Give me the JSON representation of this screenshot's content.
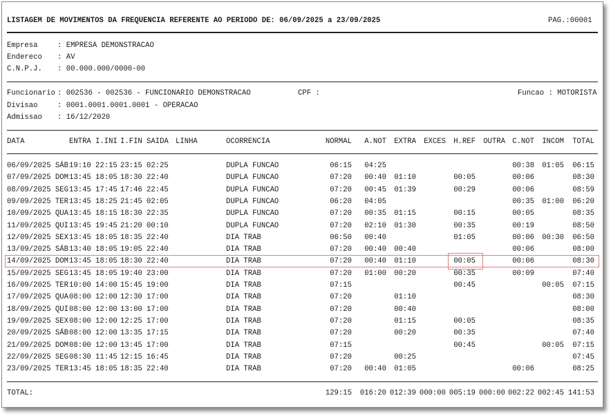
{
  "report": {
    "title": "LISTAGEM DE MOVIMENTOS DA FREQUENCIA REFERENTE AO PERIODO DE: 06/09/2025 a 23/09/2025",
    "page": "PAG.:00001"
  },
  "company": [
    {
      "label": "Empresa",
      "value": ": EMPRESA DEMONSTRACAO"
    },
    {
      "label": "Endereco",
      "value": ": AV"
    },
    {
      "label": "C.N.P.J.",
      "value": ": 00.000.000/0000-00"
    }
  ],
  "employee": {
    "funcionario_label": "Funcionario",
    "funcionario_value": ": 002536 - 002536 - FUNCIONARIO DEMONSTRACAO",
    "cpf": "CPF :",
    "funcao": "Funcao : MOTORISTA",
    "divisao_label": "Divisao",
    "divisao_value": ": 0001.0001.0001.0001 - OPERACAO",
    "admissao_label": "Admissao",
    "admissao_value": ": 16/12/2020"
  },
  "columns": {
    "data": "DATA",
    "entra": "ENTRA",
    "iini": "I.INI",
    "ifin": "I.FIN",
    "saida": "SAIDA",
    "linha": "LINHA",
    "ocorrencia": "OCORRENCIA",
    "normal": "NORMAL",
    "anot": "A.NOT",
    "extra": "EXTRA",
    "exces": "EXCES",
    "href": "H.REF",
    "outra": "OUTRA",
    "cnot": "C.NOT",
    "incom": "INCOM",
    "total": "TOTAL"
  },
  "rows": [
    {
      "date": "06/09/2025 SÁB",
      "entra": "19:10",
      "iini": "22:15",
      "ifin": "23:15",
      "saida": "02:25",
      "oc": "DUPLA FUNCAO",
      "normal": "06:15",
      "anot": "04:25",
      "extra": "",
      "href": "",
      "cnot": "00:38",
      "incom": "01:05",
      "total": "06:15"
    },
    {
      "date": "07/09/2025 DOM",
      "entra": "13:45",
      "iini": "18:05",
      "ifin": "18:30",
      "saida": "22:40",
      "oc": "DUPLA FUNCAO",
      "normal": "07:20",
      "anot": "00:40",
      "extra": "01:10",
      "href": "00:05",
      "cnot": "00:06",
      "incom": "",
      "total": "08:30"
    },
    {
      "date": "08/09/2025 SEG",
      "entra": "13:45",
      "iini": "17:45",
      "ifin": "17:46",
      "saida": "22:45",
      "oc": "DUPLA FUNCAO",
      "normal": "07:20",
      "anot": "00:45",
      "extra": "01:39",
      "href": "00:29",
      "cnot": "00:06",
      "incom": "",
      "total": "08:59"
    },
    {
      "date": "09/09/2025 TER",
      "entra": "13:45",
      "iini": "18:25",
      "ifin": "21:45",
      "saida": "02:05",
      "oc": "DUPLA FUNCAO",
      "normal": "06:20",
      "anot": "04:05",
      "extra": "",
      "href": "",
      "cnot": "00:35",
      "incom": "01:00",
      "total": "06:20"
    },
    {
      "date": "10/09/2025 QUA",
      "entra": "13:45",
      "iini": "18:15",
      "ifin": "18:30",
      "saida": "22:35",
      "oc": "DUPLA FUNCAO",
      "normal": "07:20",
      "anot": "00:35",
      "extra": "01:15",
      "href": "00:15",
      "cnot": "00:05",
      "incom": "",
      "total": "08:35"
    },
    {
      "date": "11/09/2025 QUI",
      "entra": "13:45",
      "iini": "19:45",
      "ifin": "21:20",
      "saida": "00:10",
      "oc": "DUPLA FUNCAO",
      "normal": "07:20",
      "anot": "02:10",
      "extra": "01:30",
      "href": "00:35",
      "cnot": "00:19",
      "incom": "",
      "total": "08:50"
    },
    {
      "date": "12/09/2025 SEX",
      "entra": "13:45",
      "iini": "18:05",
      "ifin": "18:35",
      "saida": "22:40",
      "oc": "DIA TRAB",
      "normal": "06:50",
      "anot": "00:40",
      "extra": "",
      "href": "01:05",
      "cnot": "00:06",
      "incom": "00:30",
      "total": "06:50"
    },
    {
      "date": "13/09/2025 SÁB",
      "entra": "13:40",
      "iini": "18:05",
      "ifin": "19:05",
      "saida": "22:40",
      "oc": "DIA TRAB",
      "normal": "07:20",
      "anot": "00:40",
      "extra": "00:40",
      "href": "",
      "cnot": "00:06",
      "incom": "",
      "total": "08:00"
    },
    {
      "date": "14/09/2025 DOM",
      "entra": "13:45",
      "iini": "18:05",
      "ifin": "18:30",
      "saida": "22:40",
      "oc": "DIA TRAB",
      "normal": "07:20",
      "anot": "00:40",
      "extra": "01:10",
      "href": "00:05",
      "cnot": "00:06",
      "incom": "",
      "total": "08:30"
    },
    {
      "date": "15/09/2025 SEG",
      "entra": "13:45",
      "iini": "18:05",
      "ifin": "19:40",
      "saida": "23:00",
      "oc": "DIA TRAB",
      "normal": "07:20",
      "anot": "01:00",
      "extra": "00:20",
      "href": "00:35",
      "cnot": "00:09",
      "incom": "",
      "total": "07:40"
    },
    {
      "date": "16/09/2025 TER",
      "entra": "10:00",
      "iini": "14:00",
      "ifin": "15:45",
      "saida": "19:00",
      "oc": "DIA TRAB",
      "normal": "07:15",
      "anot": "",
      "extra": "",
      "href": "00:45",
      "cnot": "",
      "incom": "00:05",
      "total": "07:15"
    },
    {
      "date": "17/09/2025 QUA",
      "entra": "08:00",
      "iini": "12:00",
      "ifin": "12:30",
      "saida": "17:00",
      "oc": "DIA TRAB",
      "normal": "07:20",
      "anot": "",
      "extra": "01:10",
      "href": "",
      "cnot": "",
      "incom": "",
      "total": "08:30"
    },
    {
      "date": "18/09/2025 QUI",
      "entra": "08:00",
      "iini": "12:00",
      "ifin": "13:00",
      "saida": "17:00",
      "oc": "DIA TRAB",
      "normal": "07:20",
      "anot": "",
      "extra": "00:40",
      "href": "",
      "cnot": "",
      "incom": "",
      "total": "08:00"
    },
    {
      "date": "19/09/2025 SEX",
      "entra": "08:00",
      "iini": "12:00",
      "ifin": "12:25",
      "saida": "17:00",
      "oc": "DIA TRAB",
      "normal": "07:20",
      "anot": "",
      "extra": "01:15",
      "href": "00:05",
      "cnot": "",
      "incom": "",
      "total": "08:35"
    },
    {
      "date": "20/09/2025 SÁB",
      "entra": "08:00",
      "iini": "12:00",
      "ifin": "13:35",
      "saida": "17:15",
      "oc": "DIA TRAB",
      "normal": "07:20",
      "anot": "",
      "extra": "00:20",
      "href": "00:35",
      "cnot": "",
      "incom": "",
      "total": "07:40"
    },
    {
      "date": "21/09/2025 DOM",
      "entra": "08:00",
      "iini": "12:00",
      "ifin": "13:45",
      "saida": "17:00",
      "oc": "DIA TRAB",
      "normal": "07:15",
      "anot": "",
      "extra": "",
      "href": "00:45",
      "cnot": "",
      "incom": "00:05",
      "total": "07:15"
    },
    {
      "date": "22/09/2025 SEG",
      "entra": "08:30",
      "iini": "11:45",
      "ifin": "12:15",
      "saida": "16:45",
      "oc": "DIA TRAB",
      "normal": "07:20",
      "anot": "",
      "extra": "00:25",
      "href": "",
      "cnot": "",
      "incom": "",
      "total": "07:45"
    },
    {
      "date": "23/09/2025 TER",
      "entra": "13:45",
      "iini": "18:05",
      "ifin": "18:35",
      "saida": "22:40",
      "oc": "DIA TRAB",
      "normal": "07:20",
      "anot": "00:40",
      "extra": "01:05",
      "href": "",
      "cnot": "00:06",
      "incom": "",
      "total": "08:25"
    }
  ],
  "totals": {
    "label": "TOTAL:",
    "normal": "129:15",
    "anot": "016:20",
    "extra": "012:39",
    "exces": "000:00",
    "href": "005:19",
    "outra": "000:00",
    "cnot": "002:22",
    "incom": "002:45",
    "total": "141:53"
  }
}
